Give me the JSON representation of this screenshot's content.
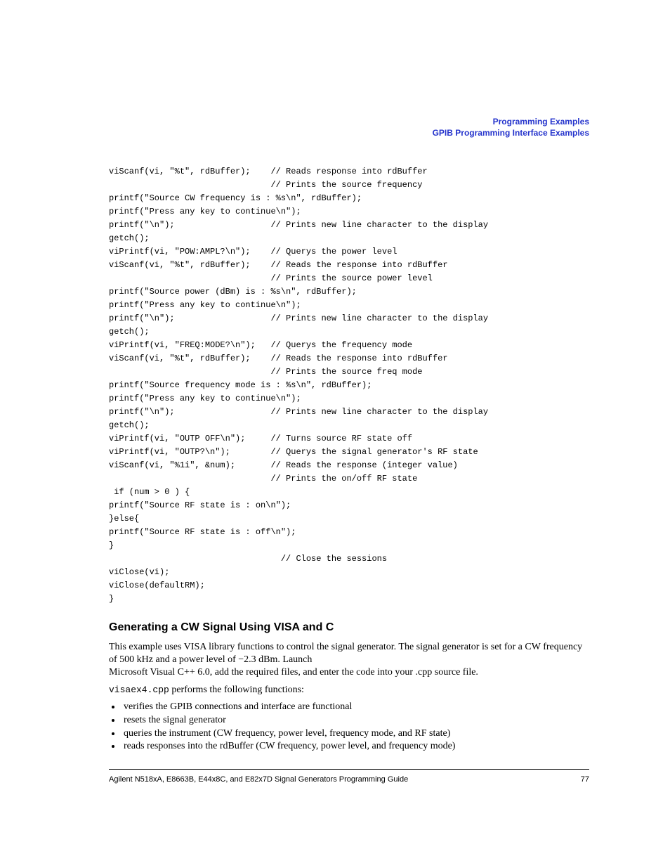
{
  "header": {
    "line1": "Programming Examples",
    "line2": "GPIB Programming Interface Examples"
  },
  "code_lines": [
    "viScanf(vi, \"%t\", rdBuffer);    // Reads response into rdBuffer",
    "                                // Prints the source frequency",
    "printf(\"Source CW frequency is : %s\\n\", rdBuffer); ",
    "printf(\"Press any key to continue\\n\");",
    "printf(\"\\n\");                   // Prints new line character to the display",
    "getch(); ",
    "viPrintf(vi, \"POW:AMPL?\\n\");    // Querys the power level",
    "viScanf(vi, \"%t\", rdBuffer);    // Reads the response into rdBuffer",
    "                                // Prints the source power level",
    "printf(\"Source power (dBm) is : %s\\n\", rdBuffer); ",
    "printf(\"Press any key to continue\\n\");",
    "printf(\"\\n\");                   // Prints new line character to the display",
    "getch(); ",
    "viPrintf(vi, \"FREQ:MODE?\\n\");   // Querys the frequency mode",
    "viScanf(vi, \"%t\", rdBuffer);    // Reads the response into rdBuffer",
    "                                // Prints the source freq mode",
    "printf(\"Source frequency mode is : %s\\n\", rdBuffer);",
    "printf(\"Press any key to continue\\n\");",
    "printf(\"\\n\");                   // Prints new line character to the display",
    "getch(); ",
    "viPrintf(vi, \"OUTP OFF\\n\");     // Turns source RF state off",
    "viPrintf(vi, \"OUTP?\\n\");        // Querys the signal generator's RF state",
    "viScanf(vi, \"%1i\", &num);       // Reads the response (integer value)",
    "                                // Prints the on/off RF state ",
    " if (num > 0 ) {",
    "printf(\"Source RF state is : on\\n\");",
    "}else{",
    "printf(\"Source RF state is : off\\n\");",
    "}",
    "                                  // Close the sessions",
    "viClose(vi);",
    "viClose(defaultRM);",
    "}"
  ],
  "section": {
    "title": "Generating a CW Signal Using VISA and C",
    "para1a": "This example uses VISA library functions to control the signal generator. The signal generator is set for a CW frequency of 500 kHz and a power level of −2.3 dBm. Launch ",
    "para1b": "Microsoft Visual C++ 6.0, add the required files, and enter the code into your .cpp source file.",
    "para2_code": "visaex4.cpp",
    "para2_rest": " performs the following functions:",
    "bullets": [
      "verifies the GPIB connections and interface are functional",
      "resets the signal generator",
      "queries the instrument (CW frequency, power level, frequency mode, and RF state)",
      "reads responses into the rdBuffer (CW frequency, power level, and frequency mode)"
    ]
  },
  "footer": {
    "left": "Agilent N518xA, E8663B, E44x8C, and E82x7D Signal Generators Programming Guide",
    "right": "77"
  }
}
